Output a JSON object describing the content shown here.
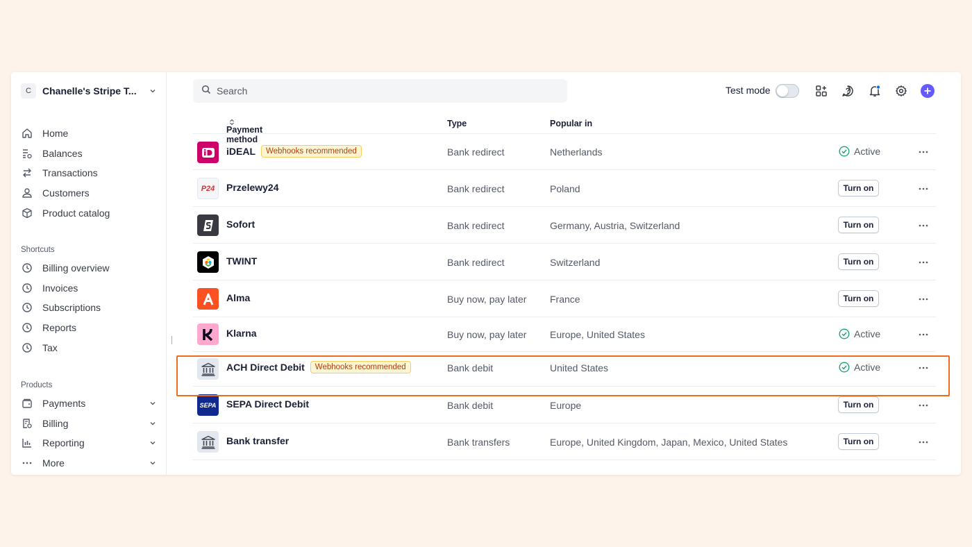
{
  "account": {
    "initial": "C",
    "name": "Chanelle's Stripe T..."
  },
  "nav": [
    {
      "label": "Home",
      "icon": "home-icon"
    },
    {
      "label": "Balances",
      "icon": "balances-icon"
    },
    {
      "label": "Transactions",
      "icon": "transactions-icon"
    },
    {
      "label": "Customers",
      "icon": "customers-icon"
    },
    {
      "label": "Product catalog",
      "icon": "product-catalog-icon"
    }
  ],
  "shortcuts": {
    "title": "Shortcuts",
    "items": [
      {
        "label": "Billing overview",
        "icon": "clock-icon"
      },
      {
        "label": "Invoices",
        "icon": "clock-icon"
      },
      {
        "label": "Subscriptions",
        "icon": "clock-icon"
      },
      {
        "label": "Reports",
        "icon": "clock-icon"
      },
      {
        "label": "Tax",
        "icon": "clock-icon"
      }
    ]
  },
  "products": {
    "title": "Products",
    "items": [
      {
        "label": "Payments",
        "icon": "payments-icon"
      },
      {
        "label": "Billing",
        "icon": "billing-icon"
      },
      {
        "label": "Reporting",
        "icon": "reporting-icon"
      },
      {
        "label": "More",
        "icon": "more-dots-icon"
      }
    ]
  },
  "search": {
    "placeholder": "Search"
  },
  "topbar": {
    "test_mode_label": "Test mode",
    "test_mode_on": false
  },
  "table": {
    "headers": {
      "method": "Payment method",
      "type": "Type",
      "popular": "Popular in"
    },
    "rows": [
      {
        "name": "iDEAL",
        "badge": "Webhooks recommended",
        "type": "Bank redirect",
        "popular": "Netherlands",
        "status": "Active",
        "logo": "ideal-logo"
      },
      {
        "name": "Przelewy24",
        "badge": "",
        "type": "Bank redirect",
        "popular": "Poland",
        "action": "Turn on",
        "logo": "p24-logo"
      },
      {
        "name": "Sofort",
        "badge": "",
        "type": "Bank redirect",
        "popular": "Germany, Austria, Switzerland",
        "action": "Turn on",
        "logo": "sofort-logo"
      },
      {
        "name": "TWINT",
        "badge": "",
        "type": "Bank redirect",
        "popular": "Switzerland",
        "action": "Turn on",
        "logo": "twint-logo"
      },
      {
        "name": "Alma",
        "badge": "",
        "type": "Buy now, pay later",
        "popular": "France",
        "action": "Turn on",
        "logo": "alma-logo"
      },
      {
        "name": "Klarna",
        "badge": "",
        "type": "Buy now, pay later",
        "popular": "Europe, United States",
        "status": "Active",
        "logo": "klarna-logo"
      },
      {
        "name": "ACH Direct Debit",
        "badge": "Webhooks recommended",
        "type": "Bank debit",
        "popular": "United States",
        "status": "Active",
        "logo": "bank-logo"
      },
      {
        "name": "SEPA Direct Debit",
        "badge": "",
        "type": "Bank debit",
        "popular": "Europe",
        "action": "Turn on",
        "logo": "sepa-logo"
      },
      {
        "name": "Bank transfer",
        "badge": "",
        "type": "Bank transfers",
        "popular": "Europe, United Kingdom, Japan, Mexico, United States",
        "action": "Turn on",
        "logo": "bank-logo"
      }
    ]
  },
  "logo_text": {
    "p24": "P24",
    "sepa": "SEPA"
  },
  "colors": {
    "accent": "#635bff",
    "highlight": "#ef6b1c",
    "active": "#1ea672",
    "badge_text": "#b3400a",
    "badge_bg": "#fcf5d4"
  }
}
